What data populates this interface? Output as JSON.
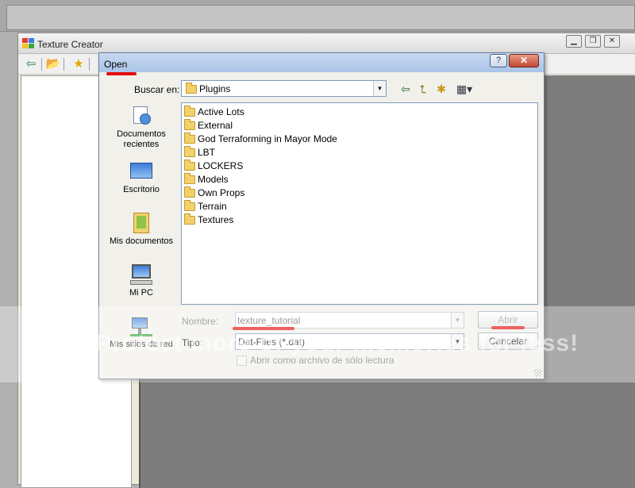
{
  "app": {
    "title": "Texture Creator",
    "controls": [
      "minimize",
      "restore",
      "close"
    ]
  },
  "dialog": {
    "title": "Open",
    "help_label": "?",
    "close_label": "✕",
    "lookin_label": "Buscar en:",
    "lookin_value": "Plugins",
    "places": [
      {
        "label": "Documentos recientes",
        "icon": "recent-documents-icon"
      },
      {
        "label": "Escritorio",
        "icon": "desktop-icon"
      },
      {
        "label": "Mis documentos",
        "icon": "my-documents-icon"
      },
      {
        "label": "Mi PC",
        "icon": "my-computer-icon"
      },
      {
        "label": "Mis sitios de red",
        "icon": "network-places-icon"
      }
    ],
    "folders": [
      "Active Lots",
      "External",
      "God Terraforming in Mayor Mode",
      "LBT",
      "LOCKERS",
      "Models",
      "Own Props",
      "Terrain",
      "Textures"
    ],
    "filename_label": "Nombre:",
    "filename_value": "texture_tutorial",
    "filetype_label": "Tipo:",
    "filetype_value": "Dat-Files (*.dat)",
    "readonly_label": "Abrir como archivo de sólo lectura",
    "open_button": "Abrir",
    "cancel_button": "Cancelar"
  },
  "watermark": {
    "text": "Protect more of your memories for less!"
  },
  "colors": {
    "annotation": "#e30d0d",
    "canvas": "#7d7d7d"
  }
}
